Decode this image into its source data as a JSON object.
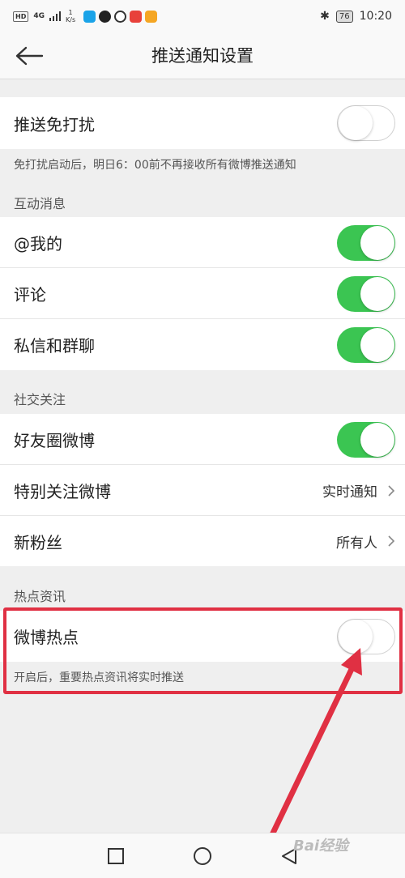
{
  "status_bar": {
    "hd": "HD",
    "network": "4G",
    "speed_value": "1",
    "speed_unit": "K/s",
    "battery": "76",
    "time": "10:20",
    "app_icon_colors": [
      "#1aa3e8",
      "#222222",
      "#333333",
      "#e8413a",
      "#f5a623"
    ]
  },
  "header": {
    "title": "推送通知设置",
    "back_icon": "arrow-left-icon"
  },
  "dnd": {
    "label": "推送免打扰",
    "enabled": false,
    "note": "免打扰启动后，明日6：00前不再接收所有微博推送通知"
  },
  "interaction": {
    "section_title": "互动消息",
    "items": [
      {
        "label": "@我的",
        "enabled": true
      },
      {
        "label": "评论",
        "enabled": true
      },
      {
        "label": "私信和群聊",
        "enabled": true
      }
    ]
  },
  "social": {
    "section_title": "社交关注",
    "friends_label": "好友圈微博",
    "friends_enabled": true,
    "special_label": "特别关注微博",
    "special_value": "实时通知",
    "followers_label": "新粉丝",
    "followers_value": "所有人"
  },
  "hot": {
    "section_title": "热点资讯",
    "label": "微博热点",
    "enabled": false,
    "note": "开启后，重要热点资讯将实时推送"
  },
  "watermark": "Bai经验",
  "colors": {
    "toggle_on": "#3bc552",
    "highlight": "#e03043"
  }
}
